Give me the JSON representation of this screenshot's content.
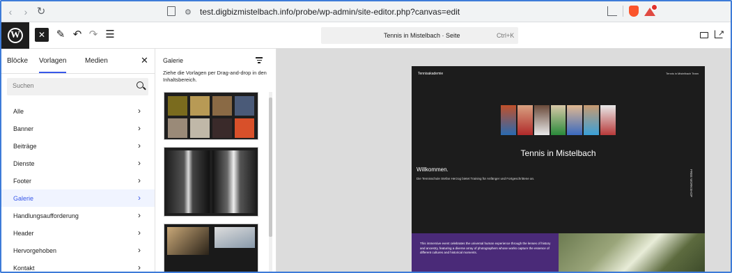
{
  "browser": {
    "url": "test.digbizmistelbach.info/probe/wp-admin/site-editor.php?canvas=edit"
  },
  "toolbar": {
    "command_title": "Tennis in Mistelbach · Seite",
    "command_shortcut": "Ctrl+K"
  },
  "sidebar": {
    "tabs": [
      {
        "label": "Blöcke"
      },
      {
        "label": "Vorlagen"
      },
      {
        "label": "Medien"
      }
    ],
    "search_placeholder": "Suchen",
    "categories": [
      {
        "label": "Alle"
      },
      {
        "label": "Banner"
      },
      {
        "label": "Beiträge"
      },
      {
        "label": "Dienste"
      },
      {
        "label": "Footer"
      },
      {
        "label": "Galerie"
      },
      {
        "label": "Handlungsaufforderung"
      },
      {
        "label": "Header"
      },
      {
        "label": "Hervorgehoben"
      },
      {
        "label": "Kontakt"
      }
    ],
    "active_category": "Galerie"
  },
  "panel": {
    "title": "Galerie",
    "description": "Ziehe die Vorlagen per Drag-and-drop in den Inhaltsbereich."
  },
  "canvas": {
    "site_name": "Tennisakademie",
    "nav": "Tennis in Mistelbach   Team",
    "hero_title": "Tennis in Mistelbach",
    "welcome": "Willkommen.",
    "intro": "Die Tennisschule Stefan Herzog bietet Training für Anfänger und Fortgeschrittene an.",
    "vertical_text": "FREE WORKSHOP",
    "purple_text": "This immersive event celebrates the universal human experience through the lenses of history and ancestry, featuring a diverse array of photographers whose works capture the essence of different cultures and historical moments."
  },
  "colors": {
    "accent": "#3858e9",
    "purple_block": "#4a2a78",
    "wp_dark": "#1e1e1e"
  }
}
